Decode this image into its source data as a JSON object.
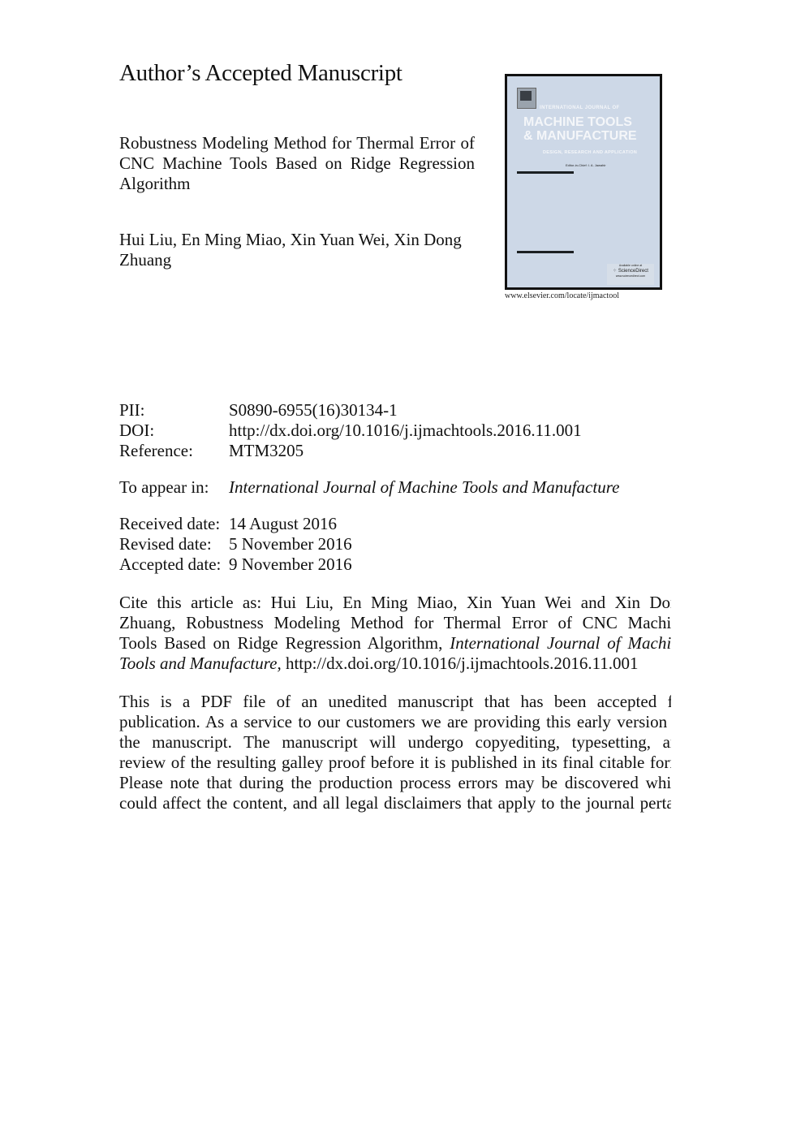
{
  "header": {
    "heading": "Author’s Accepted Manuscript"
  },
  "article": {
    "title": "Robustness Modeling Method for Thermal Error of CNC Machine Tools Based on Ridge Regression Algorithm",
    "authors_line1": "Hui Liu, En Ming Miao, Xin Yuan Wei, Xin Dong",
    "authors_line2": "Zhuang"
  },
  "cover": {
    "publisher_logo": "elsevier-tree-logo",
    "kicker": "INTERNATIONAL JOURNAL OF",
    "title_line1": "MACHINE TOOLS",
    "title_line2": "& MANUFACTURE",
    "subtitle": "DESIGN, RESEARCH AND APPLICATION",
    "editor": "Editor-in-Chief: I. A. Jawahir",
    "sciencedirect_available": "Available online at",
    "sciencedirect_name": "ScienceDirect",
    "sciencedirect_url": "www.sciencedirect.com",
    "journal_url": "www.elsevier.com/locate/ijmactool",
    "colors": {
      "background": "#cdd8e7",
      "border": "#111111",
      "title_text": "#f4f6f9"
    }
  },
  "metadata": {
    "pii_label": "PII:",
    "pii_value": "S0890-6955(16)30134-1",
    "doi_label": "DOI:",
    "doi_value": "http://dx.doi.org/10.1016/j.ijmachtools.2016.11.001",
    "reference_label": "Reference:",
    "reference_value": "MTM3205",
    "appear_label": "To appear in:",
    "appear_value": "International Journal of Machine Tools and Manufacture",
    "received_label": "Received date:",
    "received_value": "14 August 2016",
    "revised_label": "Revised date:",
    "revised_value": "5 November 2016",
    "accepted_label": "Accepted date:",
    "accepted_value": "9 November 2016"
  },
  "citation": {
    "line1": "Cite this article as: Hui Liu, En Ming Miao, Xin Yuan Wei and Xin Dong",
    "line2": "Zhuang, Robustness Modeling Method for Thermal Error of CNC Machine",
    "line3_plain": "Tools Based on Ridge Regression Algorithm,",
    "line3_italic": "International Journal of Machine",
    "line4_italic": "Tools and Manufacture,",
    "line4_plain": "http://dx.doi.org/10.1016/j.ijmachtools.2016.11.001"
  },
  "disclaimer": {
    "lines": [
      "This is a PDF file of an unedited manuscript that has been accepted for",
      "publication. As a service to our customers we are providing this early version of",
      "the manuscript. The manuscript will undergo copyediting, typesetting, and",
      "review of the resulting galley proof before it is published in its final citable form.",
      "Please note that during the production process errors may be discovered which",
      "could affect the content, and all legal disclaimers that apply to the journal pertain"
    ]
  }
}
